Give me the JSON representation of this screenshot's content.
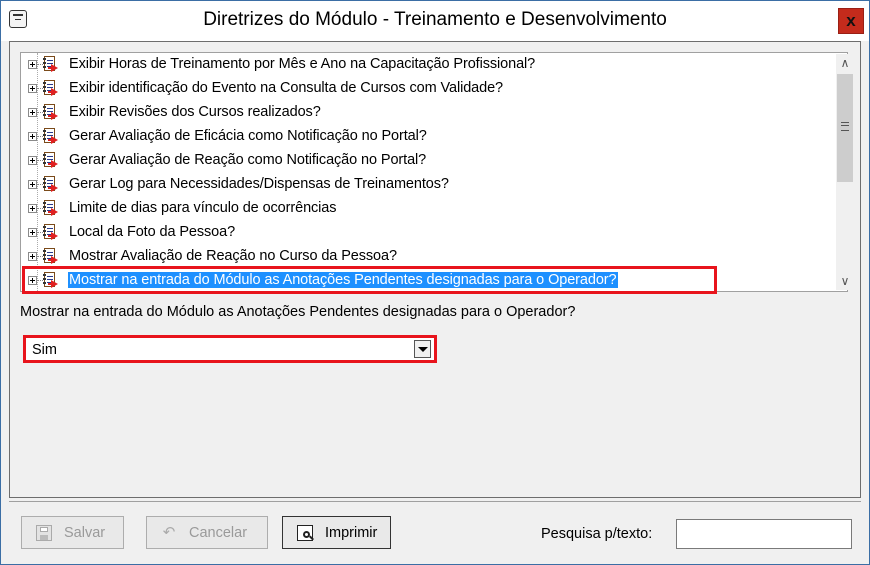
{
  "window": {
    "title": "Diretrizes do Módulo - Treinamento e Desenvolvimento",
    "close_label": "x"
  },
  "tree": {
    "items": [
      {
        "label": "Exibir Horas de Treinamento por Mês e Ano na Capacitação Profissional?",
        "selected": false
      },
      {
        "label": "Exibir identificação do Evento na Consulta de Cursos com Validade?",
        "selected": false
      },
      {
        "label": "Exibir Revisões dos Cursos realizados?",
        "selected": false
      },
      {
        "label": "Gerar Avaliação de Eficácia como Notificação no Portal?",
        "selected": false
      },
      {
        "label": "Gerar Avaliação de Reação como Notificação no Portal?",
        "selected": false
      },
      {
        "label": "Gerar Log para Necessidades/Dispensas de Treinamentos?",
        "selected": false
      },
      {
        "label": "Limite de dias para vínculo de ocorrências",
        "selected": false
      },
      {
        "label": "Local da Foto da Pessoa?",
        "selected": false
      },
      {
        "label": "Mostrar Avaliação de Reação no Curso da Pessoa?",
        "selected": false
      },
      {
        "label": "Mostrar na entrada do Módulo as Anotações Pendentes designadas para o Operador?",
        "selected": true
      }
    ]
  },
  "detail": {
    "question": "Mostrar na entrada do Módulo as Anotações Pendentes designadas para o Operador?",
    "value": "Sim"
  },
  "toolbar": {
    "save_label": "Salvar",
    "cancel_label": "Cancelar",
    "print_label": "Imprimir",
    "search_label": "Pesquisa p/texto:",
    "search_value": ""
  },
  "colors": {
    "selection": "#1e90ff",
    "highlight_border": "#e8141c",
    "close_button": "#c42b1c"
  }
}
